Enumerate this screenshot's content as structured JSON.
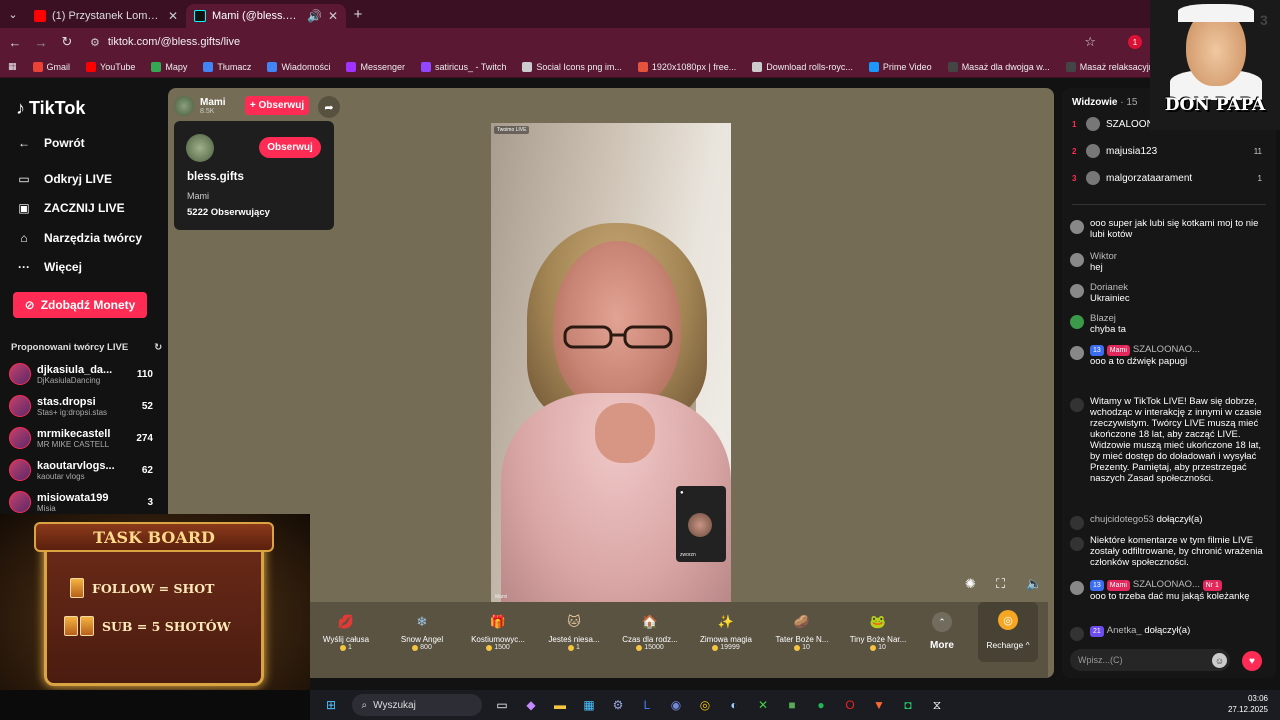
{
  "browser": {
    "tabs": [
      {
        "title": "(1) Przystanek Lombard - Odc. 1",
        "active": false,
        "favicon_color": "#ff0000"
      },
      {
        "title": "Mami (@bless.gifts) prowadzi...",
        "active": true,
        "favicon_color": "#111111"
      }
    ],
    "url": "tiktok.com/@bless.gifts/live",
    "bookmarks": [
      {
        "label": "Gmail",
        "color": "#ea4335"
      },
      {
        "label": "YouTube",
        "color": "#ff0000"
      },
      {
        "label": "Mapy",
        "color": "#34a853"
      },
      {
        "label": "Tłumacz",
        "color": "#4285f4"
      },
      {
        "label": "Wiadomości",
        "color": "#4285f4"
      },
      {
        "label": "Messenger",
        "color": "#a033ff"
      },
      {
        "label": "satiricus_ - Twitch",
        "color": "#9146ff"
      },
      {
        "label": "Social Icons png im...",
        "color": "#cccccc"
      },
      {
        "label": "1920x1080px | free...",
        "color": "#e5533d"
      },
      {
        "label": "Download rolls-royc...",
        "color": "#cccccc"
      },
      {
        "label": "Prime Video",
        "color": "#1a98ff"
      },
      {
        "label": "Masaż dla dwojga w...",
        "color": "#444444"
      },
      {
        "label": "Masaż relaksacyjny...",
        "color": "#444444"
      },
      {
        "label": "CV - CV Maker",
        "color": "#e53935"
      }
    ],
    "extension_badge": "1"
  },
  "sidebar": {
    "logo": "TikTok",
    "nav": [
      {
        "label": "Powrót",
        "icon": "arrow-left-icon"
      },
      {
        "label": "Odkryj LIVE",
        "icon": "live-tv-icon"
      },
      {
        "label": "ZACZNIJ LIVE",
        "icon": "camera-icon"
      },
      {
        "label": "Narzędzia twórcy",
        "icon": "home-icon"
      },
      {
        "label": "Więcej",
        "icon": "more-icon"
      }
    ],
    "coins_button": "Zdobądź Monety",
    "suggested_title": "Proponowani twórcy LIVE",
    "creators": [
      {
        "name": "djkasiula_da...",
        "sub": "DjKasiulaDancing",
        "count": "110"
      },
      {
        "name": "stas.dropsi",
        "sub": "Stas+ ig:dropsi.stas",
        "count": "52"
      },
      {
        "name": "mrmikecastell",
        "sub": "MR MIKE CASTELL",
        "count": "274"
      },
      {
        "name": "kaoutarvlogs...",
        "sub": "kaoutar vlogs",
        "count": "62"
      },
      {
        "name": "misiowata199",
        "sub": "Misia",
        "count": "3"
      }
    ]
  },
  "live": {
    "host_short": "Mami",
    "host_likes": "8.5K",
    "follow_small": "+ Obserwuj",
    "profile_card": {
      "username": "bless.gifts",
      "nickname": "Mami",
      "followers": "5222 Obserwujący",
      "follow_button": "Obserwuj"
    },
    "video_tag": "Twoimo LIVE",
    "video_host_label": "Mami",
    "guest_name": "zworzn",
    "gifts": [
      {
        "name": "Wyślij całusa",
        "price": "1",
        "icon": "💋",
        "color": "#e2285a"
      },
      {
        "name": "Snow Angel",
        "price": "800",
        "icon": "❄",
        "color": "#9fc8e8"
      },
      {
        "name": "Kostiumowyc...",
        "price": "1500",
        "icon": "🎁",
        "color": "#c58a3a"
      },
      {
        "name": "Jesteś niesa...",
        "price": "1",
        "icon": "🐱",
        "color": "#e8c9a0"
      },
      {
        "name": "Czas dla rodz...",
        "price": "15000",
        "icon": "🏠",
        "color": "#7a2a2a"
      },
      {
        "name": "Zimowa magia",
        "price": "19999",
        "icon": "✨",
        "color": "#c9a0e8"
      },
      {
        "name": "Tater Boże N...",
        "price": "10",
        "icon": "🥔",
        "color": "#c8a060"
      },
      {
        "name": "Tiny Boże Nar...",
        "price": "10",
        "icon": "🐸",
        "color": "#5ac85a"
      }
    ],
    "more_label": "More",
    "recharge_label": "Recharge ^"
  },
  "chat": {
    "viewers_title": "Widzowie",
    "viewers_count": "· 15",
    "top_viewers": [
      {
        "rank": "1",
        "name": "SZALOONA...",
        "score": ""
      },
      {
        "rank": "2",
        "name": "majusia123",
        "score": "11"
      },
      {
        "rank": "3",
        "name": "malgorzataarament",
        "score": "1"
      }
    ],
    "messages": [
      {
        "user": "",
        "text": "ooo super jak lubi się kotkami moj to nie lubi kotów"
      },
      {
        "user": "Wiktor",
        "text": "hej"
      },
      {
        "user": "Dorianek",
        "text": "Ukrainiec"
      },
      {
        "user": "Blazej",
        "text": "chyba ta"
      },
      {
        "user": "SZALOONAO...",
        "text": "ooo a to dźwięk papugi"
      },
      {
        "user": "",
        "text": "Witamy w TikTok LIVE! Baw się dobrze, wchodząc w interakcję z innymi w czasie rzeczywistym. Twórcy LIVE muszą mieć ukończone 18 lat, aby zacząć LIVE. Widzowie muszą mieć ukończone 18 lat, by mieć dostęp do doładowań i wysyłać Prezenty. Pamiętaj, aby przestrzegać naszych Zasad społeczności."
      },
      {
        "user": "chujcidotego53",
        "text": "dołączył(a)"
      },
      {
        "user": "",
        "text": "Niektóre komentarze w tym filmie LIVE zostały odfiltrowane, by chronić wrażenia członków społeczności."
      },
      {
        "user": "SZALOONAO...",
        "text": "ooo to trzeba dać mu jakąś koleżankę"
      },
      {
        "user": "Anetka_",
        "text": "dołączył(a)"
      }
    ],
    "badges": {
      "level1": "13",
      "level2": "21",
      "team": "Mami",
      "rank": "Nr 1"
    },
    "input_placeholder": "Wpisz...(C)"
  },
  "overlays": {
    "taskboard_title": "TASK BOARD",
    "taskboard_line1": "FOLLOW = SHOT",
    "taskboard_line2": "SUB = 5 SHOTÓW",
    "papa_title": "DON PAPA",
    "papa_number": "3"
  },
  "taskbar": {
    "search_label": "Wyszukaj",
    "time": "03:06",
    "date": "27.12.2025"
  }
}
